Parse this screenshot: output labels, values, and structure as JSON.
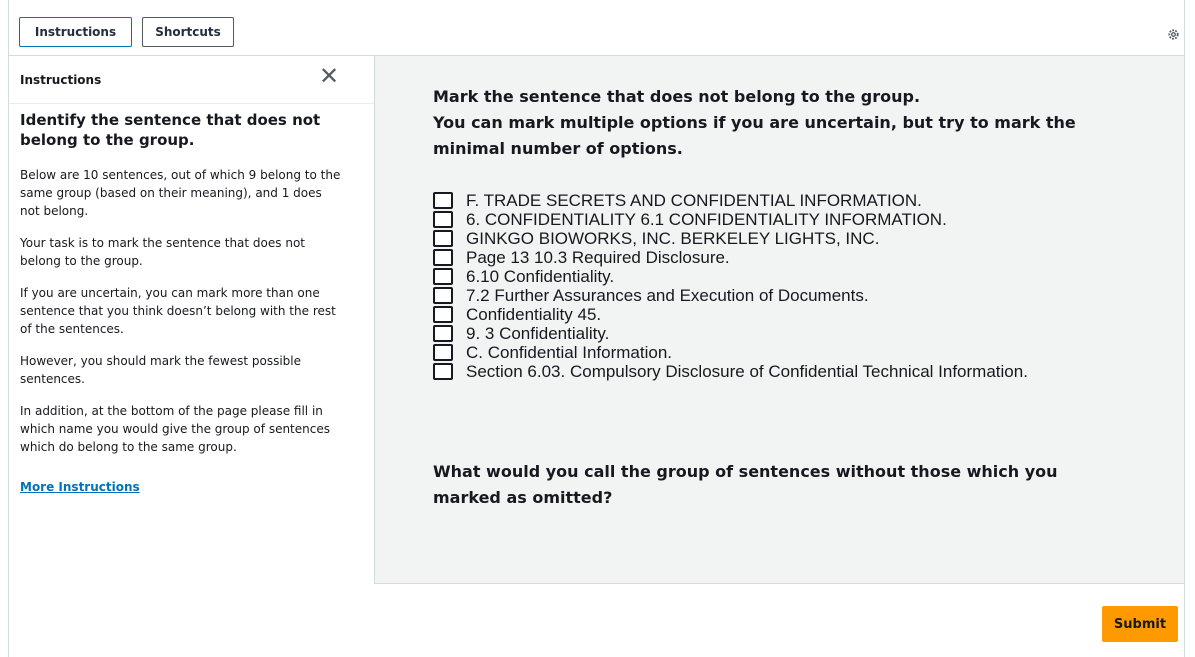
{
  "topbar": {
    "instructions_label": "Instructions",
    "shortcuts_label": "Shortcuts",
    "settings_icon": "gear-icon"
  },
  "sidebar": {
    "title": "Instructions",
    "close_icon": "close-icon",
    "heading": "Identify the sentence that does not belong to the group.",
    "paragraphs": [
      "Below are 10 sentences, out of which 9 belong to the same group (based on their meaning), and 1 does not belong.",
      "Your task is to mark the sentence that does not belong to the group.",
      "If you are uncertain, you can mark more than one sentence that you think doesn’t belong with the rest of the sentences.",
      "However, you should mark the fewest possible sentences.",
      "In addition, at the bottom of the page please fill in which name you would give the group of sentences which do belong to the same group."
    ],
    "more_link": "More Instructions"
  },
  "main": {
    "question_lines": [
      "Mark the sentence that does not belong to the group.",
      "You can mark multiple options if you are uncertain, but try to mark the",
      "minimal number of options."
    ],
    "options": [
      "F. TRADE SECRETS AND CONFIDENTIAL INFORMATION.",
      "6. CONFIDENTIALITY 6.1 CONFIDENTIALITY INFORMATION.",
      "GINKGO BIOWORKS, INC. BERKELEY LIGHTS, INC.",
      "Page 13 10.3 Required Disclosure.",
      "6.10 Confidentiality.",
      "7.2 Further Assurances and Execution of Documents.",
      "Confidentiality 45.",
      "9. 3 Confidentiality.",
      "C. Confidential Information.",
      "Section 6.03. Compulsory Disclosure of Confidential Technical Information."
    ],
    "question2_lines": [
      "What would you call the group of sentences without those which you",
      "marked as omitted?"
    ]
  },
  "footer": {
    "submit_label": "Submit"
  },
  "colors": {
    "accent_blue": "#0073bb",
    "submit_orange": "#ff9900",
    "main_bg": "#f2f3f3"
  }
}
